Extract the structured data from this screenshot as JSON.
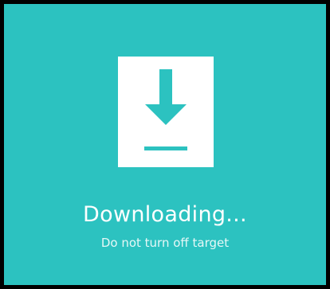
{
  "screen": {
    "background_color": "#2cc2c0",
    "border_color": "#000000",
    "icon": "download-arrow-icon",
    "icon_color": "#2cc2c0",
    "tile_color": "#ffffff",
    "title": "Downloading...",
    "subtitle": "Do not turn off target"
  }
}
